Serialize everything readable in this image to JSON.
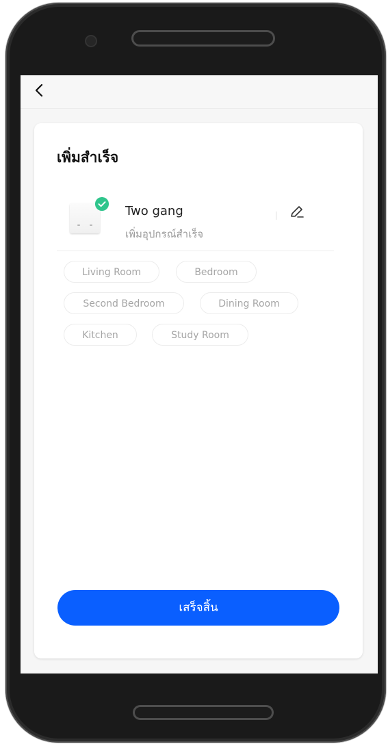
{
  "header": {
    "back_icon": "chevron-left-icon"
  },
  "card": {
    "title": "เพิ่มสำเร็จ"
  },
  "device": {
    "name": "Two gang",
    "status": "เพิ่มอุปกรณ์สำเร็จ",
    "badge_icon": "check-circle-icon",
    "edit_icon": "pencil-icon"
  },
  "rooms": [
    {
      "label": "Living Room"
    },
    {
      "label": "Bedroom"
    },
    {
      "label": "Second Bedroom"
    },
    {
      "label": "Dining Room"
    },
    {
      "label": "Kitchen"
    },
    {
      "label": "Study Room"
    }
  ],
  "done_button": {
    "label": "เสร็จสิ้น"
  },
  "colors": {
    "primary": "#0a5fff",
    "success": "#2fc58c",
    "chip_text": "#a5a5a5",
    "frame": "#1a1a1a"
  }
}
